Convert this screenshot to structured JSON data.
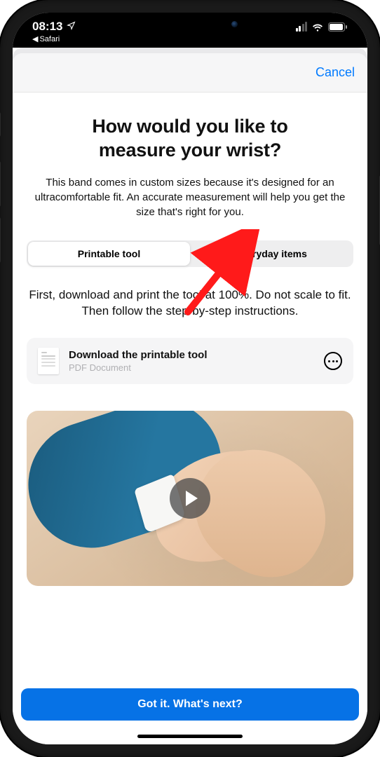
{
  "statusbar": {
    "time": "08:13",
    "back_app": "Safari"
  },
  "sheet": {
    "cancel": "Cancel",
    "title_line1": "How would you like to",
    "title_line2": "measure your wrist?",
    "subtitle": "This band comes in custom sizes because it's designed for an ultracomfortable fit. An accurate measurement will help you get the size that's right for you.",
    "seg": {
      "option1": "Printable tool",
      "option2": "Everyday items"
    },
    "instruction": "First, download and print the tool at 100%. Do not scale to fit. Then follow the step-by-step instructions.",
    "download": {
      "title": "Download the printable tool",
      "subtitle": "PDF Document"
    },
    "cta": "Got it. What's next?"
  }
}
